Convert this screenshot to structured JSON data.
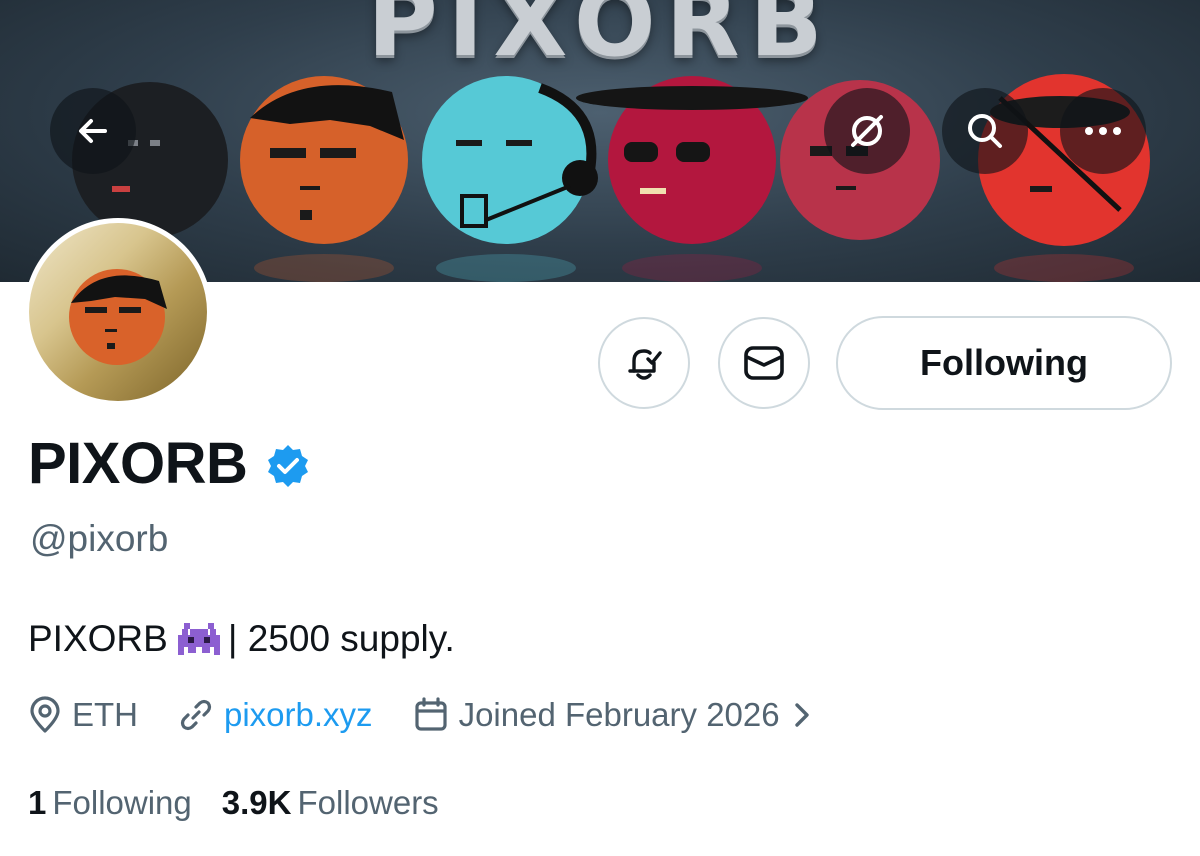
{
  "header": {
    "banner_text": "PIXORB",
    "back_icon": "arrow-left-icon",
    "grok_icon": "grok-icon",
    "search_icon": "search-icon",
    "more_icon": "more-horizontal-icon"
  },
  "profile": {
    "display_name": "PIXORB",
    "handle": "@pixorb",
    "bio_prefix": "PIXORB",
    "bio_emoji": "alien-monster-emoji",
    "bio_suffix": "| 2500 supply.",
    "location": "ETH",
    "website": "pixorb.xyz",
    "joined": "Joined February 2026",
    "verified_color": "#1d9bf0"
  },
  "actions": {
    "notify_icon": "bell-check-icon",
    "message_icon": "envelope-icon",
    "follow_label": "Following"
  },
  "stats": {
    "following_count": "1",
    "following_label": "Following",
    "followers_count": "3.9K",
    "followers_label": "Followers"
  },
  "colors": {
    "accent": "#1d9bf0",
    "text_secondary": "#536471",
    "text_primary": "#0f1419",
    "border": "#cfd9de"
  }
}
